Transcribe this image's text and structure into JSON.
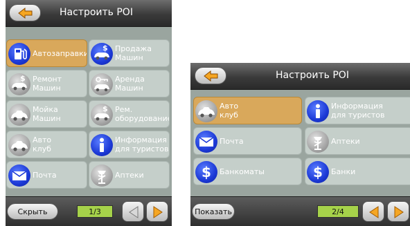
{
  "left_screen": {
    "title": "Настроить POI",
    "cells": [
      {
        "label": "Автозаправки",
        "icon": "fuel-pump-icon",
        "icon_color": "blue",
        "selected": true
      },
      {
        "label": "Продажа\nМашин",
        "icon": "car-dollar-icon",
        "icon_color": "blue",
        "selected": false
      },
      {
        "label": "Ремонт\nМашин",
        "icon": "car-dollar-icon",
        "icon_color": "grey",
        "selected": false
      },
      {
        "label": "Аренда\nМашин",
        "icon": "car-key-icon",
        "icon_color": "grey",
        "selected": false
      },
      {
        "label": "Мойка\nМашин",
        "icon": "car-icon",
        "icon_color": "grey",
        "selected": false
      },
      {
        "label": "Рем.\nоборудование",
        "icon": "car-dollar-icon",
        "icon_color": "grey",
        "selected": false
      },
      {
        "label": "Авто\nклуб",
        "icon": "car-icon",
        "icon_color": "grey",
        "selected": false
      },
      {
        "label": "Информация\nдля туристов",
        "icon": "info-icon",
        "icon_color": "blue",
        "selected": false
      },
      {
        "label": "Почта",
        "icon": "envelope-icon",
        "icon_color": "blue",
        "selected": false
      },
      {
        "label": "Аптеки",
        "icon": "pharmacy-icon",
        "icon_color": "grey",
        "selected": false
      }
    ],
    "action_label": "Скрыть",
    "page_indicator": "1/3"
  },
  "right_screen": {
    "title": "Настроить POI",
    "cells": [
      {
        "label": "Авто\nклуб",
        "icon": "car-icon",
        "icon_color": "grey",
        "selected": true
      },
      {
        "label": "Информация\nдля туристов",
        "icon": "info-icon",
        "icon_color": "blue",
        "selected": false
      },
      {
        "label": "Почта",
        "icon": "envelope-icon",
        "icon_color": "blue",
        "selected": false
      },
      {
        "label": "Аптеки",
        "icon": "pharmacy-icon",
        "icon_color": "grey",
        "selected": false
      },
      {
        "label": "Банкоматы",
        "icon": "dollar-icon",
        "icon_color": "blue",
        "selected": false
      },
      {
        "label": "Банки",
        "icon": "dollar-icon",
        "icon_color": "blue",
        "selected": false
      }
    ],
    "action_label": "Показать",
    "page_indicator": "2/4"
  },
  "colors": {
    "selected_cell": "#d9a85b",
    "cell": "#c5cfca",
    "icon_blue": "#1c39d6",
    "pager_green": "#a6d24a",
    "arrow_orange": "#f5a623"
  }
}
